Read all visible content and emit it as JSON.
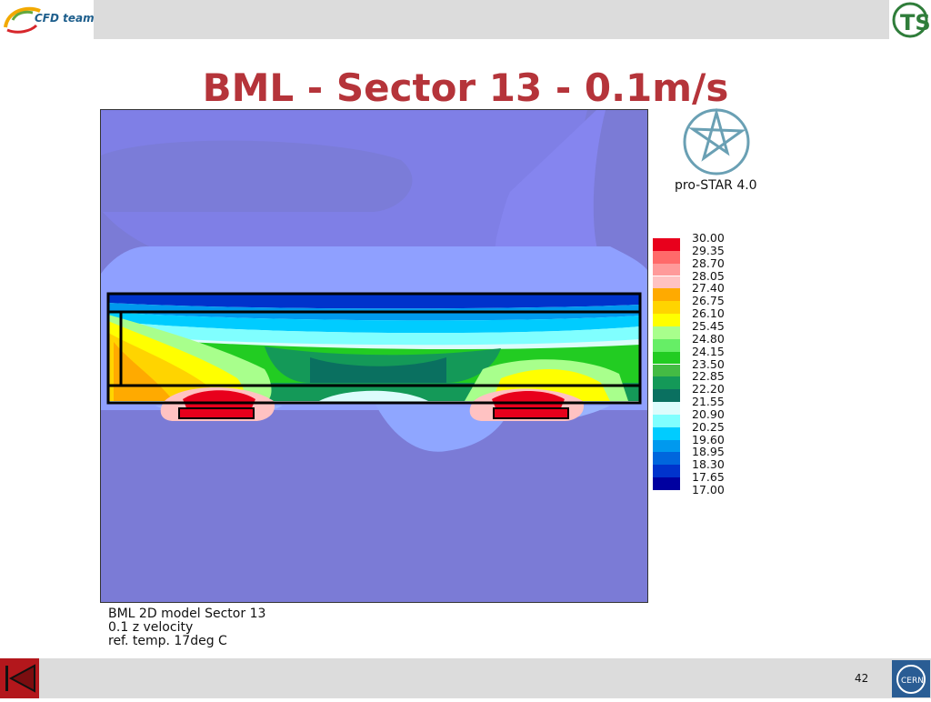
{
  "header": {
    "logo_text": "CFD team",
    "title": "BML - Sector 13 - 0.1m/s"
  },
  "software": {
    "name": "pro-STAR 4.0"
  },
  "legend": {
    "labels": [
      "30.00",
      "29.35",
      "28.70",
      "28.05",
      "27.40",
      "26.75",
      "26.10",
      "25.45",
      "24.80",
      "24.15",
      "23.50",
      "22.85",
      "22.20",
      "21.55",
      "20.90",
      "20.25",
      "19.60",
      "18.95",
      "18.30",
      "17.65",
      "17.00"
    ],
    "colors": [
      "#e8001c",
      "#ff6a6a",
      "#ff9a9a",
      "#ffc2c2",
      "#ffaa00",
      "#ffd400",
      "#ffff00",
      "#a8ff8c",
      "#66ee66",
      "#22cc22",
      "#44bb44",
      "#149958",
      "#0a7060",
      "#dcfcfc",
      "#80ffff",
      "#00ccff",
      "#0099ee",
      "#0066dd",
      "#0033cc",
      "#0000a0"
    ]
  },
  "caption": {
    "line1": "BML 2D model Sector 13",
    "line2": "0.1 z velocity",
    "line3": "ref. temp. 17deg C"
  },
  "footer": {
    "page_number": "42",
    "org_logo": "CERN"
  }
}
